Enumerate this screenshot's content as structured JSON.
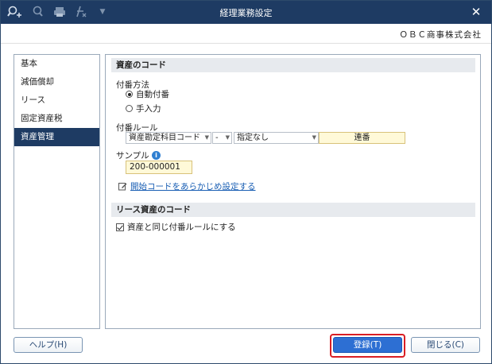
{
  "window": {
    "title": "経理業務設定",
    "company": "ＯＢＣ商事株式会社"
  },
  "toolbar": {
    "icons": [
      "search-plus-icon",
      "search-icon",
      "print-icon",
      "formula-icon",
      "menu-caret-icon"
    ]
  },
  "sidebar": {
    "items": [
      {
        "label": "基本",
        "active": false
      },
      {
        "label": "減価償却",
        "active": false
      },
      {
        "label": "リース",
        "active": false
      },
      {
        "label": "固定資産税",
        "active": false
      },
      {
        "label": "資産管理",
        "active": true
      }
    ]
  },
  "asset_code": {
    "heading": "資産のコード",
    "numbering_method_label": "付番方法",
    "auto_label": "自動付番",
    "manual_label": "手入力",
    "selected": "auto",
    "rule_label": "付番ルール",
    "rule_select1": "資産勘定科目コード",
    "rule_select2": "-",
    "rule_select3": "指定なし",
    "rule_serial": "連番",
    "sample_label": "サンプル",
    "sample_value": "200-000001",
    "link_label": "開始コードをあらかじめ設定する"
  },
  "lease_code": {
    "heading": "リース資産のコード",
    "same_rule_label": "資産と同じ付番ルールにする",
    "same_rule_checked": true
  },
  "footer": {
    "help_label": "ヘルプ(H)",
    "register_label": "登録(T)",
    "close_label": "閉じる(C)"
  },
  "colors": {
    "titlebar": "#1e3b63",
    "active_sidebar": "#1e3b63",
    "primary_button": "#2d6fd3",
    "highlight_outline": "#d91e24",
    "field_fill": "#fff9d8"
  }
}
